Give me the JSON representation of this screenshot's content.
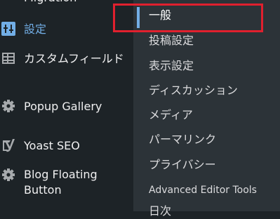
{
  "sidebar": {
    "items": [
      {
        "label": "Migration",
        "icon": "none"
      },
      {
        "label": "設定",
        "icon": "settings-sliders-icon"
      },
      {
        "label": "カスタムフィールド",
        "icon": "table-icon"
      },
      {
        "label": "Popup Gallery",
        "icon": "gear-icon"
      },
      {
        "label": "Yoast SEO",
        "icon": "yoast-icon"
      },
      {
        "label": "Blog Floating Button",
        "icon": "gear-icon"
      }
    ]
  },
  "submenu": {
    "items": [
      {
        "label": "一般",
        "active": true
      },
      {
        "label": "投稿設定"
      },
      {
        "label": "表示設定"
      },
      {
        "label": "ディスカッション"
      },
      {
        "label": "メディア"
      },
      {
        "label": "パーマリンク"
      },
      {
        "label": "プライバシー"
      },
      {
        "label": "Advanced Editor Tools"
      },
      {
        "label": "日次"
      }
    ]
  },
  "colors": {
    "sidebar_bg": "#1d2327",
    "submenu_bg": "#2c3338",
    "accent": "#72aee6",
    "highlight": "#e0202e"
  }
}
